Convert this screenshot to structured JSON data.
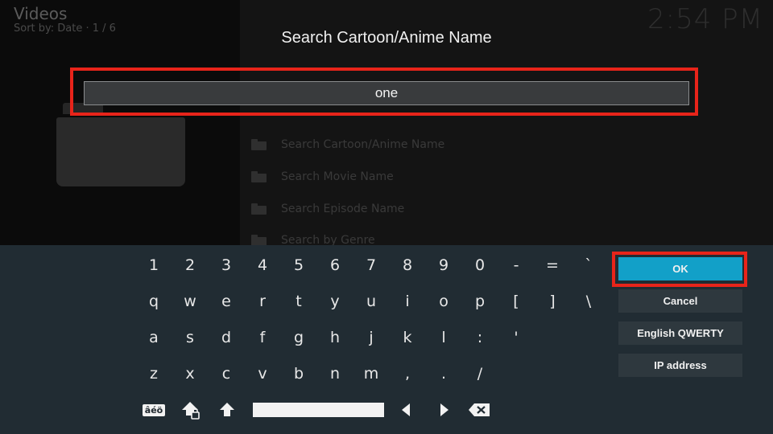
{
  "background": {
    "window_title": "Videos",
    "sort_info": "Sort by: Date  ·  1 / 6",
    "clock": "2:54 PM",
    "list_items": [
      "Search Cartoon/Anime Name",
      "Search Movie Name",
      "Search Episode Name",
      "Search by Genre"
    ]
  },
  "dialog": {
    "title": "Search Cartoon/Anime Name",
    "input_value": "one"
  },
  "keyboard": {
    "rows": [
      [
        "1",
        "2",
        "3",
        "4",
        "5",
        "6",
        "7",
        "8",
        "9",
        "0",
        "-",
        "=",
        "`"
      ],
      [
        "q",
        "w",
        "e",
        "r",
        "t",
        "y",
        "u",
        "i",
        "o",
        "p",
        "[",
        "]",
        "\\"
      ],
      [
        "a",
        "s",
        "d",
        "f",
        "g",
        "h",
        "j",
        "k",
        "l",
        ":",
        "'"
      ],
      [
        "z",
        "x",
        "c",
        "v",
        "b",
        "n",
        "m",
        ",",
        ".",
        "/"
      ]
    ],
    "symbols_label": "âéö",
    "icons": [
      "caps-lock-icon",
      "shift-icon",
      "space-bar",
      "arrow-left-icon",
      "arrow-right-icon",
      "backspace-icon"
    ]
  },
  "buttons": {
    "ok": "OK",
    "cancel": "Cancel",
    "layout": "English QWERTY",
    "ip": "IP address"
  },
  "colors": {
    "accent": "#12a0c8",
    "highlight": "#e8241a",
    "keyboard_bg": "#212c33"
  }
}
